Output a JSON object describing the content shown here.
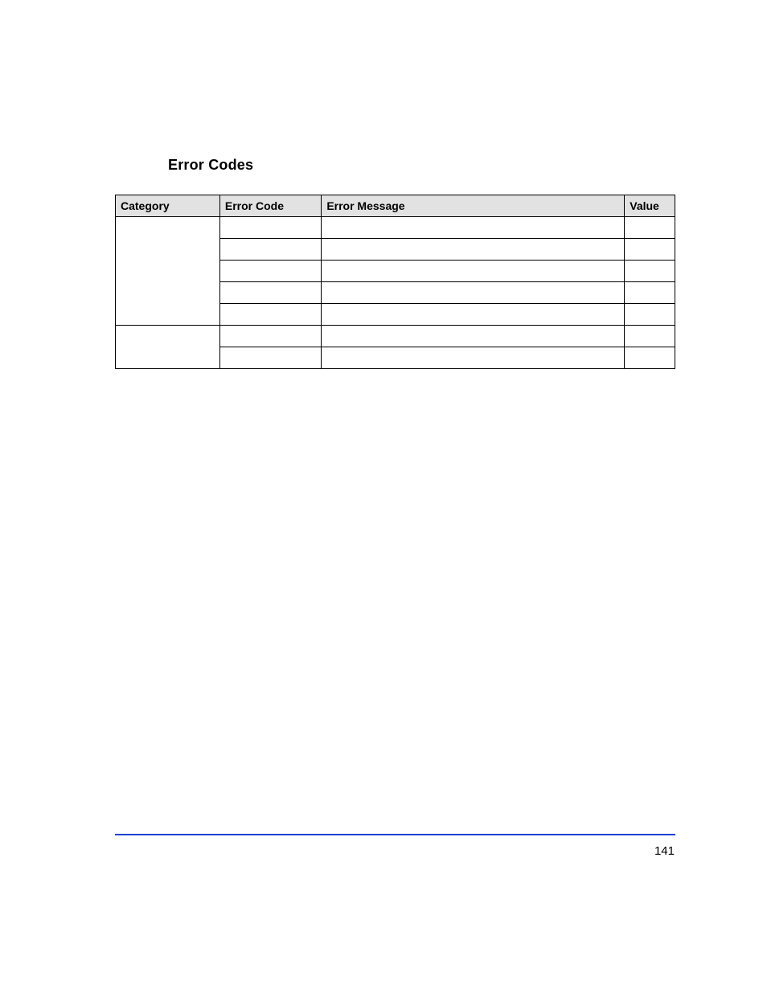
{
  "title": "Error Codes",
  "table": {
    "headers": {
      "category": "Category",
      "error_code": "Error Code",
      "error_message": "Error Message",
      "value": "Value"
    },
    "rows": [
      {
        "category": "",
        "error_code": "",
        "error_message": "",
        "value": "",
        "group": 1
      },
      {
        "category": "",
        "error_code": "",
        "error_message": "",
        "value": "",
        "group": 1
      },
      {
        "category": "",
        "error_code": "",
        "error_message": "",
        "value": "",
        "group": 1
      },
      {
        "category": "",
        "error_code": "",
        "error_message": "",
        "value": "",
        "group": 1
      },
      {
        "category": "",
        "error_code": "",
        "error_message": "",
        "value": "",
        "group": 1
      },
      {
        "category": "",
        "error_code": "",
        "error_message": "",
        "value": "",
        "group": 2
      },
      {
        "category": "",
        "error_code": "",
        "error_message": "",
        "value": "",
        "group": 2
      }
    ]
  },
  "page_number": "141"
}
